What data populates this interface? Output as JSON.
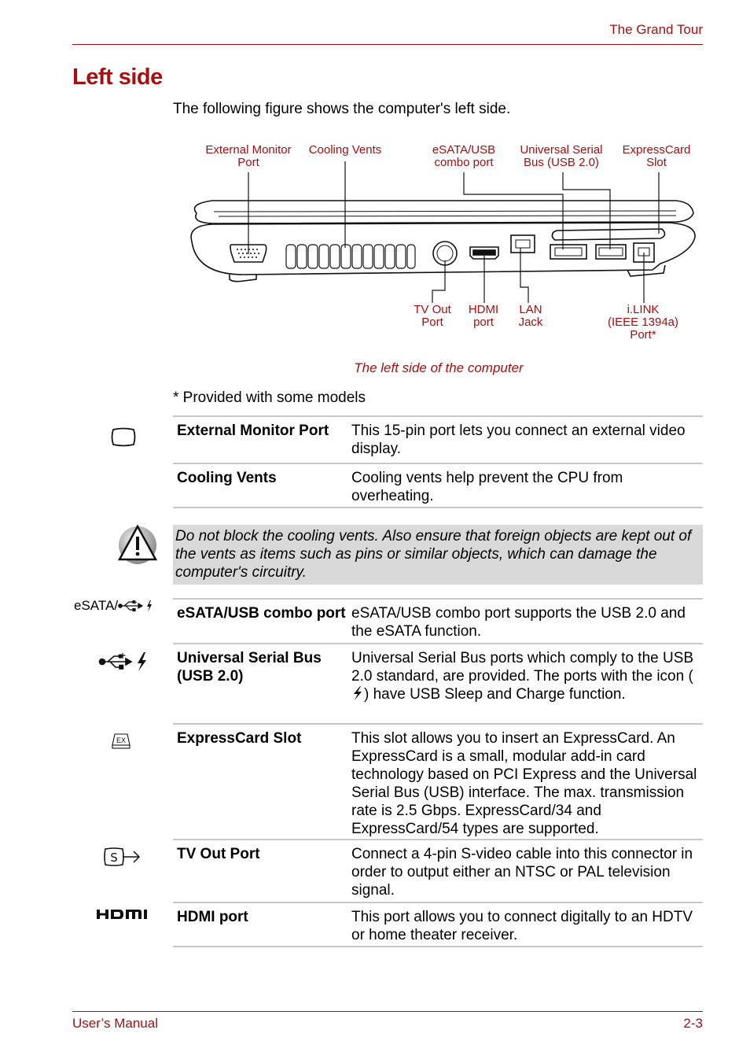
{
  "header": {
    "section": "The Grand Tour"
  },
  "title": "Left side",
  "intro": "The following figure shows the computer's left side.",
  "figure": {
    "top_labels": [
      {
        "line1": "External Monitor",
        "line2": "Port"
      },
      {
        "line1": "Cooling Vents",
        "line2": ""
      },
      {
        "line1": "eSATA/USB",
        "line2": "combo port"
      },
      {
        "line1": "Universal Serial",
        "line2": "Bus (USB 2.0)"
      },
      {
        "line1": "ExpressCard",
        "line2": "Slot"
      }
    ],
    "bottom_labels": [
      {
        "line1": "TV Out",
        "line2": "Port",
        "line3": ""
      },
      {
        "line1": "HDMI",
        "line2": "port",
        "line3": ""
      },
      {
        "line1": "LAN",
        "line2": "Jack",
        "line3": ""
      },
      {
        "line1": "i.LINK",
        "line2": "(IEEE 1394a)",
        "line3": "Port*"
      }
    ],
    "caption": "The left side of the computer"
  },
  "footnote": "* Provided with some models",
  "rows": [
    {
      "icon": "monitor-icon",
      "icon_text": "",
      "term": "External Monitor Port",
      "desc": "This 15-pin port lets you connect an external video display."
    },
    {
      "icon": "",
      "icon_text": "",
      "term": "Cooling Vents",
      "desc": "Cooling vents help prevent the CPU from overheating."
    },
    {
      "icon": "esata-usb-icon",
      "icon_text": "eSATA/",
      "term": "eSATA/USB combo port",
      "desc": "eSATA/USB combo port supports the USB 2.0 and the eSATA function."
    },
    {
      "icon": "usb-icon",
      "icon_text": "",
      "term": "Universal Serial Bus (USB 2.0)",
      "desc_pre": "Universal Serial Bus ports which comply to the USB 2.0 standard, are provided. The ports with the icon (",
      "desc_post": ") have USB Sleep and Charge function."
    },
    {
      "icon": "expresscard-icon",
      "icon_text": "EX",
      "term": "ExpressCard Slot",
      "desc": "This slot allows you to insert an ExpressCard. An ExpressCard is a small, modular add-in card technology based on PCI Express and the Universal Serial Bus (USB) interface. The max. transmission rate is 2.5 Gbps. ExpressCard/34 and ExpressCard/54 types are supported."
    },
    {
      "icon": "svideo-icon",
      "icon_text": "S",
      "term": "TV Out Port",
      "desc": "Connect a 4-pin S-video cable into this connector in order to output either an NTSC or PAL television signal."
    },
    {
      "icon": "hdmi-icon",
      "icon_text": "HDMI",
      "term": "HDMI port",
      "desc": "This port allows you to connect digitally to an HDTV or home theater receiver."
    }
  ],
  "caution": {
    "icon": "warning-icon",
    "text": "Do not block the cooling vents. Also ensure that foreign objects are kept out of the vents as items such as pins or similar objects, which can damage the computer's circuitry."
  },
  "footer": {
    "left": "User’s Manual",
    "right": "2-3"
  },
  "colors": {
    "accent": "#a50f0f",
    "rule": "#c8c8c8",
    "caution_bg": "#d9d9d9"
  }
}
